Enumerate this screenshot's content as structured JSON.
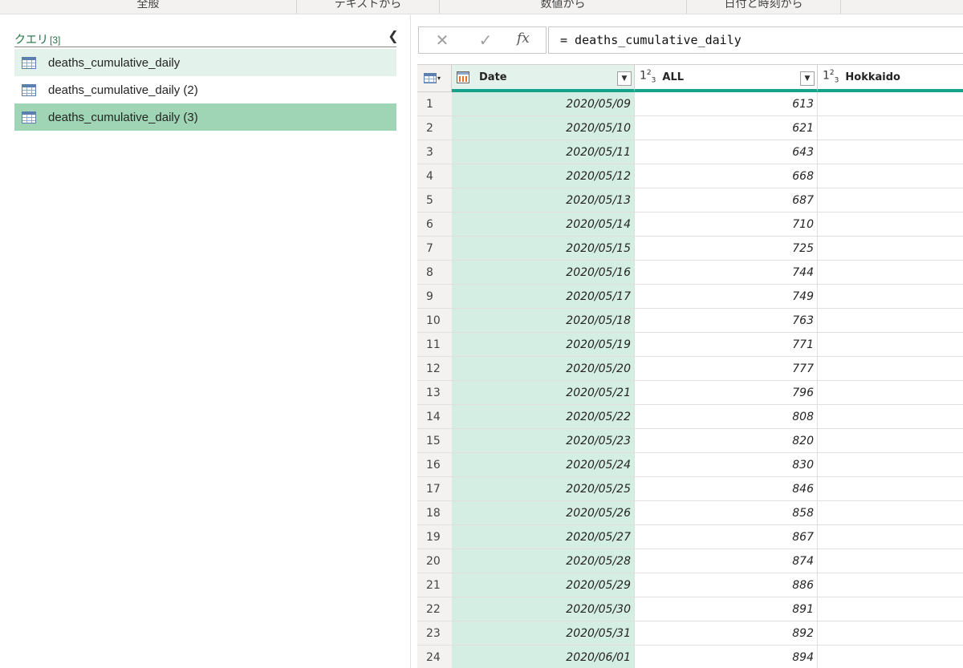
{
  "ribbon": {
    "groups": [
      "全般",
      "テキストから",
      "数値から",
      "日付と時刻から"
    ]
  },
  "queries": {
    "title": "クエリ",
    "count": "[3]",
    "items": [
      {
        "label": "deaths_cumulative_daily",
        "state": "hover"
      },
      {
        "label": "deaths_cumulative_daily (2)",
        "state": "normal"
      },
      {
        "label": "deaths_cumulative_daily (3)",
        "state": "selected"
      }
    ]
  },
  "formula_bar": {
    "cancel": "✕",
    "confirm": "✓",
    "fx": "fx",
    "formula": "= deaths_cumulative_daily"
  },
  "grid": {
    "columns": [
      {
        "name": "Date",
        "type_icon": "calendar-icon"
      },
      {
        "name": "ALL",
        "type_icon": "whole-number-icon",
        "type_label": "123"
      },
      {
        "name": "Hokkaido",
        "type_icon": "whole-number-icon",
        "type_label": "123"
      }
    ],
    "rows": [
      {
        "n": "1",
        "date": "2020/05/09",
        "all": "613",
        "hokkaido": ""
      },
      {
        "n": "2",
        "date": "2020/05/10",
        "all": "621",
        "hokkaido": ""
      },
      {
        "n": "3",
        "date": "2020/05/11",
        "all": "643",
        "hokkaido": ""
      },
      {
        "n": "4",
        "date": "2020/05/12",
        "all": "668",
        "hokkaido": ""
      },
      {
        "n": "5",
        "date": "2020/05/13",
        "all": "687",
        "hokkaido": ""
      },
      {
        "n": "6",
        "date": "2020/05/14",
        "all": "710",
        "hokkaido": ""
      },
      {
        "n": "7",
        "date": "2020/05/15",
        "all": "725",
        "hokkaido": ""
      },
      {
        "n": "8",
        "date": "2020/05/16",
        "all": "744",
        "hokkaido": ""
      },
      {
        "n": "9",
        "date": "2020/05/17",
        "all": "749",
        "hokkaido": ""
      },
      {
        "n": "10",
        "date": "2020/05/18",
        "all": "763",
        "hokkaido": ""
      },
      {
        "n": "11",
        "date": "2020/05/19",
        "all": "771",
        "hokkaido": ""
      },
      {
        "n": "12",
        "date": "2020/05/20",
        "all": "777",
        "hokkaido": ""
      },
      {
        "n": "13",
        "date": "2020/05/21",
        "all": "796",
        "hokkaido": ""
      },
      {
        "n": "14",
        "date": "2020/05/22",
        "all": "808",
        "hokkaido": ""
      },
      {
        "n": "15",
        "date": "2020/05/23",
        "all": "820",
        "hokkaido": ""
      },
      {
        "n": "16",
        "date": "2020/05/24",
        "all": "830",
        "hokkaido": ""
      },
      {
        "n": "17",
        "date": "2020/05/25",
        "all": "846",
        "hokkaido": ""
      },
      {
        "n": "18",
        "date": "2020/05/26",
        "all": "858",
        "hokkaido": ""
      },
      {
        "n": "19",
        "date": "2020/05/27",
        "all": "867",
        "hokkaido": ""
      },
      {
        "n": "20",
        "date": "2020/05/28",
        "all": "874",
        "hokkaido": ""
      },
      {
        "n": "21",
        "date": "2020/05/29",
        "all": "886",
        "hokkaido": ""
      },
      {
        "n": "22",
        "date": "2020/05/30",
        "all": "891",
        "hokkaido": ""
      },
      {
        "n": "23",
        "date": "2020/05/31",
        "all": "892",
        "hokkaido": ""
      },
      {
        "n": "24",
        "date": "2020/06/01",
        "all": "894",
        "hokkaido": ""
      }
    ]
  },
  "colors": {
    "accent": "#13a38a",
    "selected_query": "#9fd5b5",
    "selected_column": "#d5eee3",
    "query_title": "#217346"
  }
}
